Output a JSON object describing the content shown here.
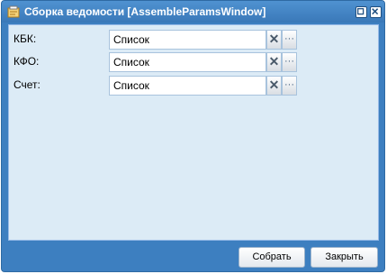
{
  "window": {
    "title": "Сборка ведомости [AssembleParamsWindow]",
    "maximize_icon": "maximize-icon",
    "close_icon": "close-icon",
    "title_icon": "window-icon"
  },
  "form": {
    "fields": [
      {
        "label": "КБК:",
        "value": "Список",
        "clear_icon": "clear-icon",
        "clear_glyph": "✕",
        "select_glyph": "···"
      },
      {
        "label": "КФО:",
        "value": "Список",
        "clear_icon": "clear-icon",
        "clear_glyph": "✕",
        "select_glyph": "···"
      },
      {
        "label": "Счет:",
        "value": "Список",
        "clear_icon": "clear-icon",
        "clear_glyph": "✕",
        "select_glyph": "···"
      }
    ]
  },
  "buttons": {
    "assemble": "Собрать",
    "close": "Закрыть"
  },
  "colors": {
    "frame": "#3d7fc0",
    "panel": "#dcebf6"
  }
}
